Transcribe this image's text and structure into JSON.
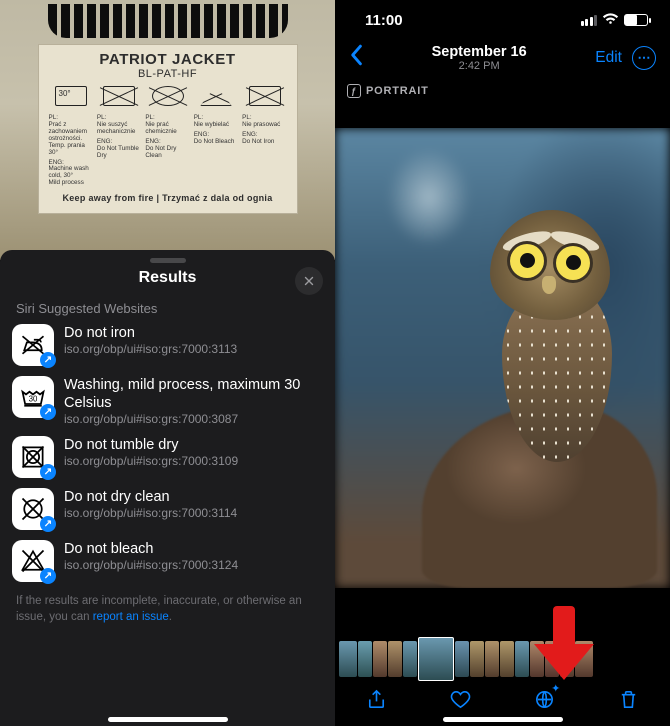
{
  "left": {
    "tag": {
      "title": "PATRIOT JACKET",
      "subtitle": "BL-PAT-HF",
      "cols": [
        {
          "pl": "PL:\nPrać z zachowaniem ostrożności.\nTemp. prania 30°",
          "eng": "ENG:\nMachine wash cold, 30°\nMild process"
        },
        {
          "pl": "PL:\nNie suszyć mechanicznie",
          "eng": "ENG:\nDo Not Tumble Dry"
        },
        {
          "pl": "PL:\nNie prać chemicznie",
          "eng": "ENG:\nDo Not Dry Clean"
        },
        {
          "pl": "PL:\nNie wybielać",
          "eng": "ENG:\nDo Not Bleach"
        },
        {
          "pl": "PL:\nNie prasować",
          "eng": "ENG:\nDo Not Iron"
        }
      ],
      "keep_away": "Keep away from fire | Trzymać z dala od ognia"
    },
    "sheet": {
      "title": "Results",
      "section": "Siri Suggested Websites",
      "items": [
        {
          "title": "Do not iron",
          "sub": "iso.org/obp/ui#iso:grs:7000:3113",
          "icon": "iron-x"
        },
        {
          "title": "Washing, mild process, maximum 30 Celsius",
          "sub": "iso.org/obp/ui#iso:grs:7000:3087",
          "icon": "wash-30"
        },
        {
          "title": "Do not tumble dry",
          "sub": "iso.org/obp/ui#iso:grs:7000:3109",
          "icon": "tumble-x"
        },
        {
          "title": "Do not dry clean",
          "sub": "iso.org/obp/ui#iso:grs:7000:3114",
          "icon": "circle-x"
        },
        {
          "title": "Do not bleach",
          "sub": "iso.org/obp/ui#iso:grs:7000:3124",
          "icon": "bleach-x"
        }
      ],
      "footer_prefix": "If the results are incomplete, inaccurate, or otherwise an issue, you can ",
      "footer_link": "report an issue",
      "footer_suffix": "."
    }
  },
  "right": {
    "status": {
      "time": "11:00"
    },
    "nav": {
      "date": "September 16",
      "time": "2:42 PM",
      "edit": "Edit"
    },
    "badge": "PORTRAIT",
    "thumb_widths": [
      18,
      14,
      14,
      14,
      14,
      36,
      14,
      14,
      14,
      14,
      14,
      14,
      14,
      14,
      18
    ]
  }
}
